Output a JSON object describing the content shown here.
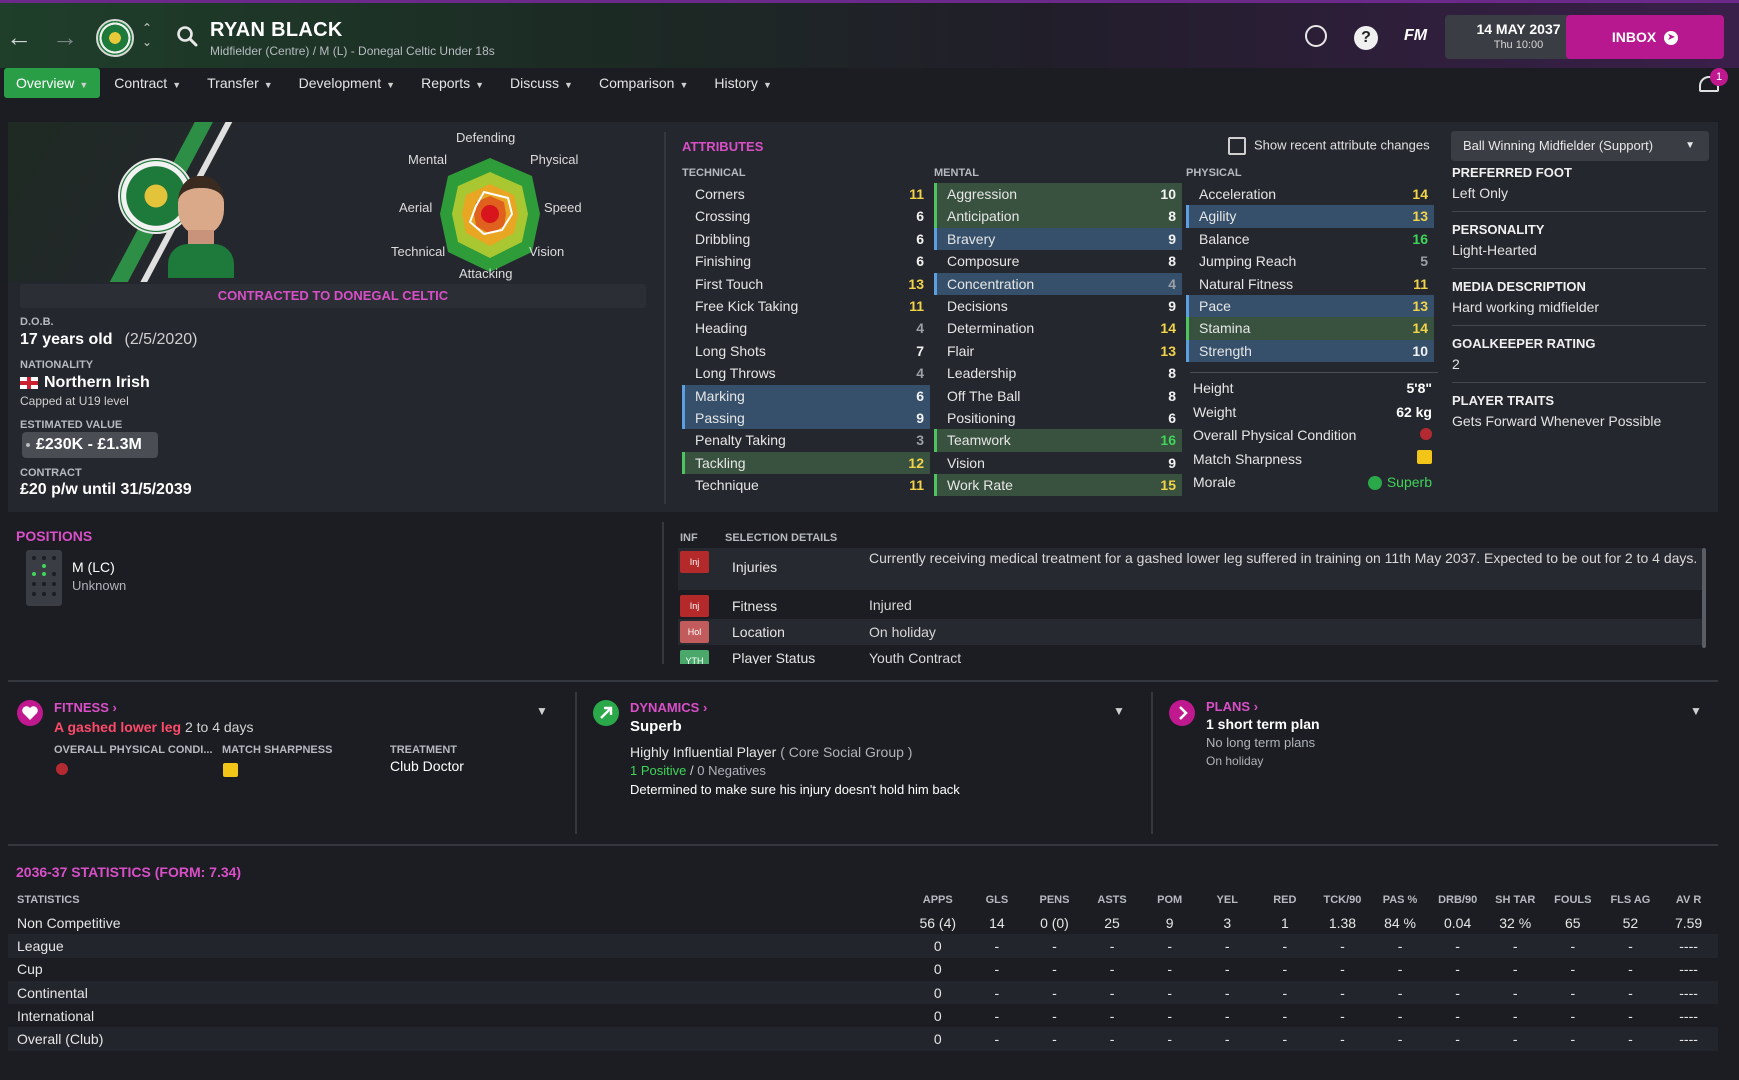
{
  "header": {
    "player_name": "RYAN BLACK",
    "player_sub": "Midfielder (Centre) / M (L) - Donegal Celtic Under 18s",
    "date": "14 MAY 2037",
    "time": "Thu 10:00",
    "fm_label": "FM",
    "help_label": "?",
    "inbox_label": "INBOX",
    "notification_count": "1"
  },
  "tabs": [
    {
      "label": "Overview"
    },
    {
      "label": "Contract"
    },
    {
      "label": "Transfer"
    },
    {
      "label": "Development"
    },
    {
      "label": "Reports"
    },
    {
      "label": "Discuss"
    },
    {
      "label": "Comparison"
    },
    {
      "label": "History"
    }
  ],
  "profile": {
    "radar_labels": {
      "top": "Defending",
      "top_left": "Mental",
      "top_right": "Physical",
      "left": "Aerial",
      "right": "Speed",
      "bottom_left": "Technical",
      "bottom_right": "Vision",
      "bottom": "Attacking"
    },
    "contracted": "CONTRACTED TO DONEGAL CELTIC",
    "dob_label": "D.O.B.",
    "age": "17 years old",
    "dob": "(2/5/2020)",
    "nationality_label": "NATIONALITY",
    "nationality": "Northern Irish",
    "capped": "Capped at U19 level",
    "value_label": "ESTIMATED VALUE",
    "value": "£230K - £1.3M",
    "contract_label": "CONTRACT",
    "contract": "£20 p/w until 31/5/2039"
  },
  "attributes": {
    "title": "ATTRIBUTES",
    "show_changes": "Show recent attribute changes",
    "role": "Ball Winning Midfielder (Support)",
    "technical_label": "TECHNICAL",
    "mental_label": "MENTAL",
    "physical_label": "PHYSICAL",
    "technical": [
      {
        "name": "Corners",
        "value": "11"
      },
      {
        "name": "Crossing",
        "value": "6"
      },
      {
        "name": "Dribbling",
        "value": "6"
      },
      {
        "name": "Finishing",
        "value": "6"
      },
      {
        "name": "First Touch",
        "value": "13"
      },
      {
        "name": "Free Kick Taking",
        "value": "11"
      },
      {
        "name": "Heading",
        "value": "4"
      },
      {
        "name": "Long Shots",
        "value": "7"
      },
      {
        "name": "Long Throws",
        "value": "4"
      },
      {
        "name": "Marking",
        "value": "6"
      },
      {
        "name": "Passing",
        "value": "9"
      },
      {
        "name": "Penalty Taking",
        "value": "3"
      },
      {
        "name": "Tackling",
        "value": "12"
      },
      {
        "name": "Technique",
        "value": "11"
      }
    ],
    "mental": [
      {
        "name": "Aggression",
        "value": "10"
      },
      {
        "name": "Anticipation",
        "value": "8"
      },
      {
        "name": "Bravery",
        "value": "9"
      },
      {
        "name": "Composure",
        "value": "8"
      },
      {
        "name": "Concentration",
        "value": "4"
      },
      {
        "name": "Decisions",
        "value": "9"
      },
      {
        "name": "Determination",
        "value": "14"
      },
      {
        "name": "Flair",
        "value": "13"
      },
      {
        "name": "Leadership",
        "value": "8"
      },
      {
        "name": "Off The Ball",
        "value": "8"
      },
      {
        "name": "Positioning",
        "value": "6"
      },
      {
        "name": "Teamwork",
        "value": "16"
      },
      {
        "name": "Vision",
        "value": "9"
      },
      {
        "name": "Work Rate",
        "value": "15"
      }
    ],
    "physical": [
      {
        "name": "Acceleration",
        "value": "14"
      },
      {
        "name": "Agility",
        "value": "13"
      },
      {
        "name": "Balance",
        "value": "16"
      },
      {
        "name": "Jumping Reach",
        "value": "5"
      },
      {
        "name": "Natural Fitness",
        "value": "11"
      },
      {
        "name": "Pace",
        "value": "13"
      },
      {
        "name": "Stamina",
        "value": "14"
      },
      {
        "name": "Strength",
        "value": "10"
      }
    ],
    "physical_extra": {
      "height_label": "Height",
      "height": "5'8\"",
      "weight_label": "Weight",
      "weight": "62 kg",
      "condition_label": "Overall Physical Condition",
      "sharpness_label": "Match Sharpness",
      "morale_label": "Morale",
      "morale": "Superb"
    }
  },
  "side_info": {
    "foot_label": "PREFERRED FOOT",
    "foot": "Left Only",
    "personality_label": "PERSONALITY",
    "personality": "Light-Hearted",
    "media_label": "MEDIA DESCRIPTION",
    "media": "Hard working midfielder",
    "gk_label": "GOALKEEPER RATING",
    "gk": "2",
    "traits_label": "PLAYER TRAITS",
    "traits": "Gets Forward Whenever Possible"
  },
  "positions": {
    "title": "POSITIONS",
    "name": "M (LC)",
    "familiarity": "Unknown"
  },
  "selection": {
    "inf_label": "INF",
    "details_label": "SELECTION DETAILS",
    "rows": [
      {
        "badge": "Inj",
        "label": "Injuries",
        "text": "Currently receiving medical treatment for a gashed lower leg suffered in training on 11th May 2037. Expected to be out for 2 to 4 days."
      },
      {
        "badge": "Inj",
        "label": "Fitness",
        "text": "Injured"
      },
      {
        "badge": "Hol",
        "label": "Location",
        "text": "On holiday"
      },
      {
        "badge": "YTH",
        "label": "Player Status",
        "text": "Youth Contract"
      }
    ]
  },
  "fitness": {
    "title": "FITNESS",
    "injury": "A gashed lower leg",
    "duration": "2 to 4 days",
    "condition_label": "OVERALL PHYSICAL CONDI...",
    "sharpness_label": "MATCH SHARPNESS",
    "treatment_label": "TREATMENT",
    "treatment": "Club Doctor"
  },
  "dynamics": {
    "title": "DYNAMICS",
    "status": "Superb",
    "influence": "Highly Influential Player",
    "group": "( Core Social Group )",
    "positives": "1 Positive",
    "separator": "/",
    "negatives": "0 Negatives",
    "note": "Determined to make sure his injury doesn't hold him back"
  },
  "plans": {
    "title": "PLANS",
    "short": "1 short term plan",
    "long": "No long term plans",
    "status": "On holiday"
  },
  "stats": {
    "title": "2036-37 STATISTICS (FORM: 7.34)",
    "headers": [
      "STATISTICS",
      "APPS",
      "GLS",
      "PENS",
      "ASTS",
      "POM",
      "YEL",
      "RED",
      "TCK/90",
      "PAS %",
      "DRB/90",
      "SH TAR",
      "FOULS",
      "FLS AG",
      "AV R"
    ],
    "rows": [
      [
        "Non Competitive",
        "56 (4)",
        "14",
        "0 (0)",
        "25",
        "9",
        "3",
        "1",
        "1.38",
        "84 %",
        "0.04",
        "32 %",
        "65",
        "52",
        "7.59"
      ],
      [
        "League",
        "0",
        "-",
        "-",
        "-",
        "-",
        "-",
        "-",
        "-",
        "-",
        "-",
        "-",
        "-",
        "-",
        "----"
      ],
      [
        "Cup",
        "0",
        "-",
        "-",
        "-",
        "-",
        "-",
        "-",
        "-",
        "-",
        "-",
        "-",
        "-",
        "-",
        "----"
      ],
      [
        "Continental",
        "0",
        "-",
        "-",
        "-",
        "-",
        "-",
        "-",
        "-",
        "-",
        "-",
        "-",
        "-",
        "-",
        "----"
      ],
      [
        "International",
        "0",
        "-",
        "-",
        "-",
        "-",
        "-",
        "-",
        "-",
        "-",
        "-",
        "-",
        "-",
        "-",
        "----"
      ],
      [
        "Overall (Club)",
        "0",
        "-",
        "-",
        "-",
        "-",
        "-",
        "-",
        "-",
        "-",
        "-",
        "-",
        "-",
        "-",
        "----"
      ]
    ]
  }
}
